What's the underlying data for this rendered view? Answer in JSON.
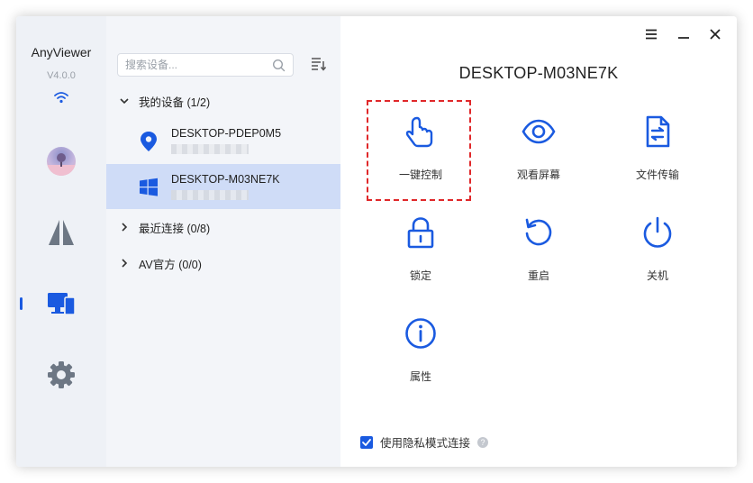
{
  "app": {
    "name": "AnyViewer",
    "version": "V4.0.0"
  },
  "colors": {
    "accent": "#1a5ae0",
    "selection_border": "#e0282a",
    "active_row": "#cfdcf7"
  },
  "search": {
    "placeholder": "搜索设备..."
  },
  "groups": {
    "my_devices": "我的设备 (1/2)",
    "recent": "最近连接 (0/8)",
    "av_official": "AV官方 (0/0)"
  },
  "devices": [
    {
      "name": "DESKTOP-PDEP0M5",
      "icon": "location-pin-icon",
      "active": false
    },
    {
      "name": "DESKTOP-M03NE7K",
      "icon": "windows-icon",
      "active": true
    }
  ],
  "main": {
    "title": "DESKTOP-M03NE7K",
    "actions": [
      {
        "label": "一键控制",
        "icon": "touch-hand-icon",
        "selected": true
      },
      {
        "label": "观看屏幕",
        "icon": "eye-icon"
      },
      {
        "label": "文件传输",
        "icon": "file-transfer-icon"
      },
      {
        "label": "锁定",
        "icon": "lock-icon"
      },
      {
        "label": "重启",
        "icon": "restart-icon"
      },
      {
        "label": "关机",
        "icon": "power-icon"
      },
      {
        "label": "属性",
        "icon": "info-icon"
      }
    ],
    "privacy_label": "使用隐私模式连接",
    "privacy_checked": true
  }
}
